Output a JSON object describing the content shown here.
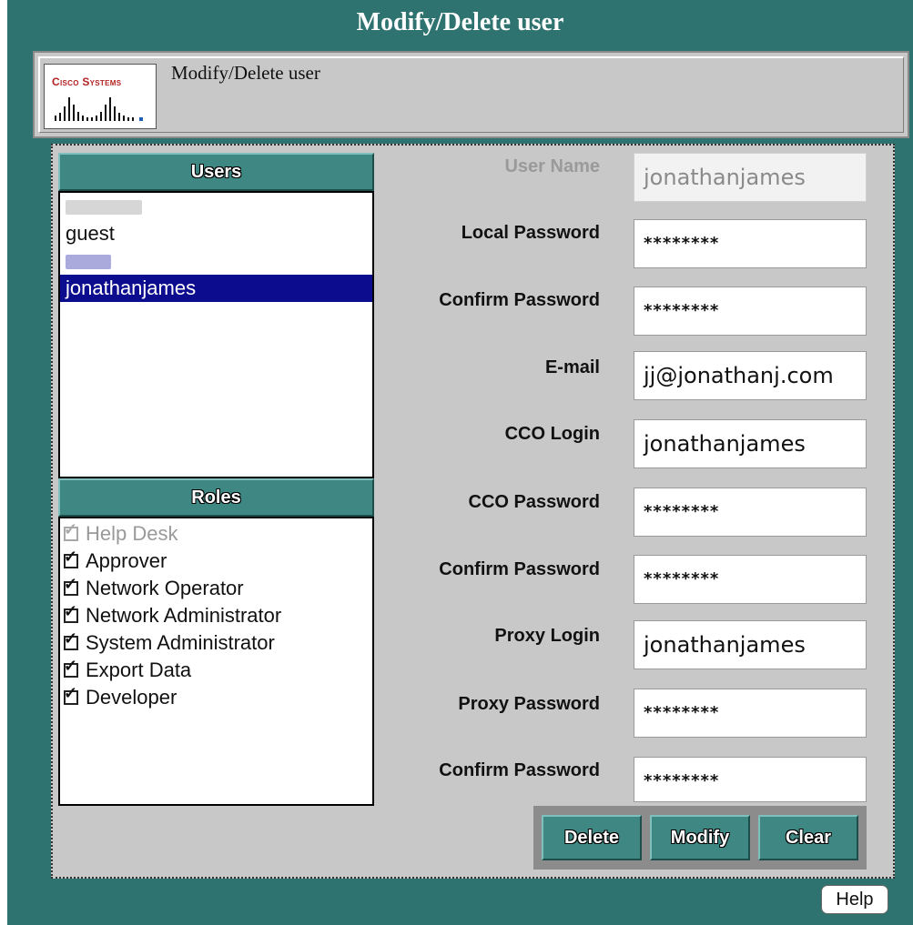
{
  "window": {
    "title": "Modify/Delete user"
  },
  "header": {
    "logo_text": "Cisco Systems",
    "title": "Modify/Delete user"
  },
  "users_panel": {
    "heading": "Users",
    "items": [
      "",
      "guest",
      "",
      "jonathanjames"
    ],
    "selected": "jonathanjames"
  },
  "roles_panel": {
    "heading": "Roles",
    "items": [
      {
        "label": "Help Desk",
        "checked": true,
        "enabled": false
      },
      {
        "label": "Approver",
        "checked": true,
        "enabled": true
      },
      {
        "label": "Network Operator",
        "checked": true,
        "enabled": true
      },
      {
        "label": "Network Administrator",
        "checked": true,
        "enabled": true
      },
      {
        "label": "System Administrator",
        "checked": true,
        "enabled": true
      },
      {
        "label": "Export Data",
        "checked": true,
        "enabled": true
      },
      {
        "label": "Developer",
        "checked": true,
        "enabled": true
      }
    ]
  },
  "form": {
    "user_name": {
      "label": "User Name",
      "value": "jonathanjames"
    },
    "local_password": {
      "label": "Local Password",
      "value": "********"
    },
    "confirm_local_password": {
      "label": "Confirm Password",
      "value": "********"
    },
    "email": {
      "label": "E-mail",
      "value": "jj@jonathanj.com"
    },
    "cco_login": {
      "label": "CCO Login",
      "value": "jonathanjames"
    },
    "cco_password": {
      "label": "CCO Password",
      "value": "********"
    },
    "confirm_cco_password": {
      "label": "Confirm Password",
      "value": "********"
    },
    "proxy_login": {
      "label": "Proxy Login",
      "value": "jonathanjames"
    },
    "proxy_password": {
      "label": "Proxy Password",
      "value": "********"
    },
    "confirm_proxy_password": {
      "label": "Confirm Password",
      "value": "********"
    }
  },
  "buttons": {
    "delete": "Delete",
    "modify": "Modify",
    "clear": "Clear",
    "help": "Help"
  },
  "colors": {
    "window_bg": "#2e7370",
    "panel_bg": "#c8c8c8",
    "header_button": "#3f8782",
    "selection": "#0c0c8e"
  }
}
